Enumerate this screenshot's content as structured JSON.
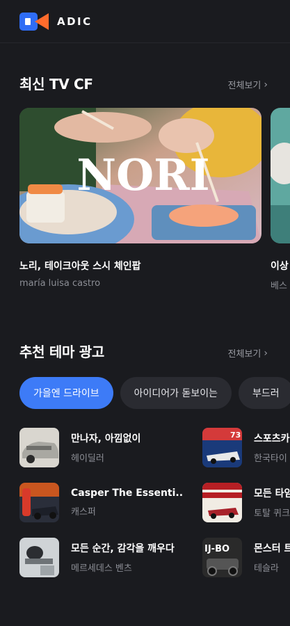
{
  "brand": {
    "name": "ADIC"
  },
  "tvcf": {
    "title": "최신 TV CF",
    "see_all": "전체보기",
    "cards": [
      {
        "thumb_text": "NORI",
        "title": "노리, 테이크아웃 스시 체인팝",
        "subtitle": "maría luisa castro"
      },
      {
        "title": "이상",
        "subtitle": "베스"
      }
    ]
  },
  "themes": {
    "title": "추천 테마 광고",
    "see_all": "전체보기",
    "pills": [
      {
        "label": "가을엔 드라이브",
        "active": true
      },
      {
        "label": "아이디어가 돋보이는",
        "active": false
      },
      {
        "label": "부드러",
        "active": false
      }
    ],
    "items": [
      {
        "title": "만나자, 아낌없이",
        "subtitle": "헤이딜러"
      },
      {
        "title": "스포츠카",
        "subtitle": "한국타이",
        "thumb_text": "73"
      },
      {
        "title": "Casper The Essenti..",
        "subtitle": "캐스퍼"
      },
      {
        "title": "모든 타임",
        "subtitle": "토탈 퀴크"
      },
      {
        "title": "모든 순간, 감각을 깨우다",
        "subtitle": "메르세데스 벤츠"
      },
      {
        "title": "몬스터 트",
        "subtitle": "테슬라",
        "thumb_text": "IJ-BO"
      }
    ]
  },
  "colors": {
    "background": "#1a1b1f",
    "accent": "#3d7bf7",
    "logo_orange": "#ff6b2c",
    "logo_blue": "#2f6df6"
  }
}
